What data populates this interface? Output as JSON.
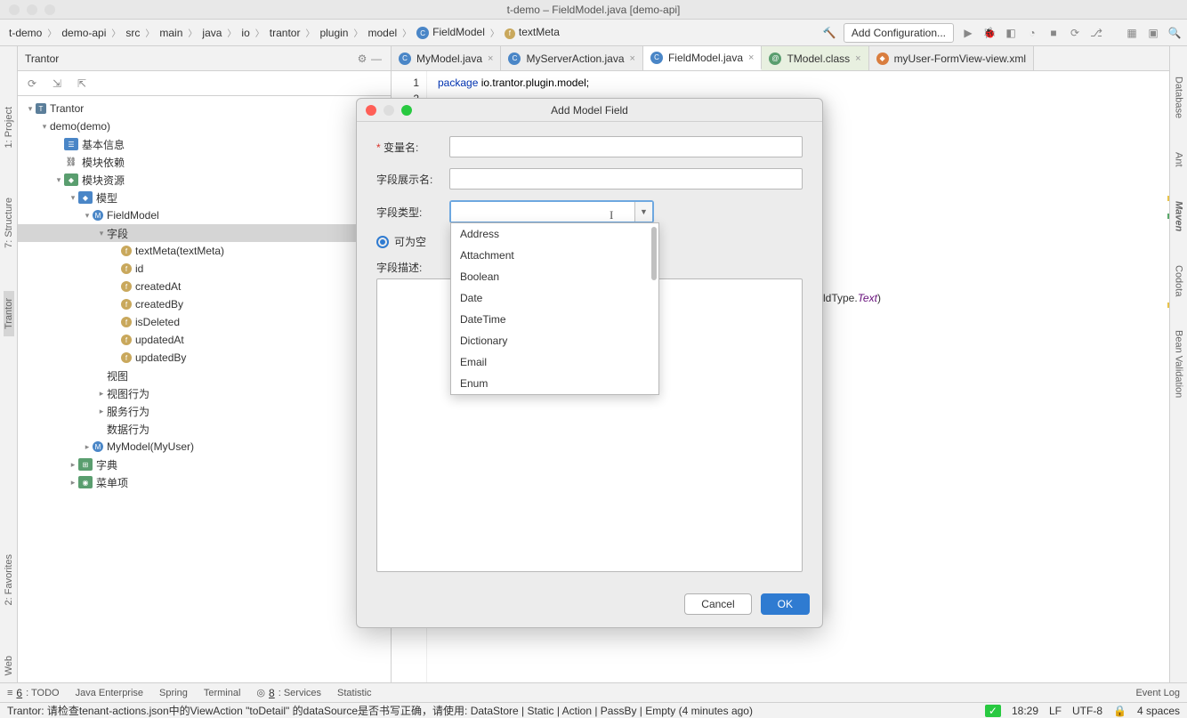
{
  "window": {
    "title": "t-demo – FieldModel.java [demo-api]"
  },
  "breadcrumb": [
    "t-demo",
    "demo-api",
    "src",
    "main",
    "java",
    "io",
    "trantor",
    "plugin",
    "model",
    "FieldModel",
    "textMeta"
  ],
  "breadcrumb_icons": {
    "9": "C",
    "10": "f"
  },
  "run_config": "Add Configuration...",
  "tool_window": {
    "title": "Trantor"
  },
  "tree": [
    {
      "d": 0,
      "a": "▾",
      "i": "T",
      "cls": "ic-T",
      "l": "Trantor"
    },
    {
      "d": 1,
      "a": "▾",
      "i": "",
      "cls": "ic-folder",
      "l": "demo(demo)"
    },
    {
      "d": 2,
      "a": "",
      "i": "☰",
      "cls": "ic-blue",
      "l": "基本信息"
    },
    {
      "d": 2,
      "a": "",
      "i": "⛓",
      "cls": "",
      "l": "模块依赖"
    },
    {
      "d": 2,
      "a": "▾",
      "i": "◆",
      "cls": "ic-green",
      "l": "模块资源"
    },
    {
      "d": 3,
      "a": "▾",
      "i": "◆",
      "cls": "ic-blue",
      "l": "模型"
    },
    {
      "d": 4,
      "a": "▾",
      "i": "M",
      "cls": "ic-m",
      "l": "FieldModel"
    },
    {
      "d": 5,
      "a": "▾",
      "i": "",
      "cls": "",
      "l": "字段",
      "sel": true
    },
    {
      "d": 6,
      "a": "",
      "i": "f",
      "cls": "ic-f",
      "l": "textMeta(textMeta)"
    },
    {
      "d": 6,
      "a": "",
      "i": "f",
      "cls": "ic-f",
      "l": "id"
    },
    {
      "d": 6,
      "a": "",
      "i": "f",
      "cls": "ic-f",
      "l": "createdAt"
    },
    {
      "d": 6,
      "a": "",
      "i": "f",
      "cls": "ic-f",
      "l": "createdBy"
    },
    {
      "d": 6,
      "a": "",
      "i": "f",
      "cls": "ic-f",
      "l": "isDeleted"
    },
    {
      "d": 6,
      "a": "",
      "i": "f",
      "cls": "ic-f",
      "l": "updatedAt"
    },
    {
      "d": 6,
      "a": "",
      "i": "f",
      "cls": "ic-f",
      "l": "updatedBy"
    },
    {
      "d": 5,
      "a": "",
      "i": "",
      "cls": "",
      "l": "视图"
    },
    {
      "d": 5,
      "a": "▸",
      "i": "",
      "cls": "",
      "l": "视图行为"
    },
    {
      "d": 5,
      "a": "▸",
      "i": "",
      "cls": "",
      "l": "服务行为"
    },
    {
      "d": 5,
      "a": "",
      "i": "",
      "cls": "",
      "l": "数据行为"
    },
    {
      "d": 4,
      "a": "▸",
      "i": "M",
      "cls": "ic-m",
      "l": "MyModel(MyUser)"
    },
    {
      "d": 3,
      "a": "▸",
      "i": "⊞",
      "cls": "ic-green",
      "l": "字典"
    },
    {
      "d": 3,
      "a": "▸",
      "i": "◉",
      "cls": "ic-green",
      "l": "菜单项"
    }
  ],
  "tabs": [
    {
      "icon": "C",
      "cls": "ic-c",
      "label": "MyModel.java",
      "close": true
    },
    {
      "icon": "C",
      "cls": "ic-c",
      "label": "MyServerAction.java",
      "close": true
    },
    {
      "icon": "C",
      "cls": "ic-c",
      "label": "FieldModel.java",
      "close": true,
      "active": true
    },
    {
      "icon": "@",
      "cls": "ic-g",
      "label": "TModel.class",
      "close": true,
      "modified": true
    },
    {
      "icon": "◆",
      "cls": "ic-x",
      "label": "myUser-FormView-view.xml",
      "close": false
    }
  ],
  "code": {
    "lines": [
      "1",
      "2"
    ],
    "line1_kw": "package",
    "line1_rest": " io.trantor.plugin.model;",
    "frag": "ldType.",
    "frag_ital": "Text",
    "frag_end": ")"
  },
  "dialog": {
    "title": "Add Model Field",
    "labels": {
      "var": "变量名:",
      "display": "字段展示名:",
      "type": "字段类型:",
      "nullable": "可为空",
      "desc": "字段描述:"
    },
    "buttons": {
      "cancel": "Cancel",
      "ok": "OK"
    }
  },
  "dropdown": [
    "Address",
    "Attachment",
    "Boolean",
    "Date",
    "DateTime",
    "Dictionary",
    "Email",
    "Enum"
  ],
  "right_panels": [
    "Database",
    "Ant",
    "Maven",
    "Codota",
    "Bean Validation"
  ],
  "left_panels": [
    "1: Project",
    "7: Structure",
    "Trantor",
    "2: Favorites",
    "Web"
  ],
  "bottom_tools": [
    "6: TODO",
    "Java Enterprise",
    "Spring",
    "Terminal",
    "8: Services",
    "Statistic"
  ],
  "event_log": "Event Log",
  "status": {
    "msg": "Trantor: 请检查tenant-actions.json中的ViewAction \"toDetail\" 的dataSource是否书写正确，请使用:  DataStore | Static | Action | PassBy | Empty (4 minutes ago)",
    "time": "18:29",
    "le": "LF",
    "enc": "UTF-8",
    "spaces": "4 spaces"
  }
}
